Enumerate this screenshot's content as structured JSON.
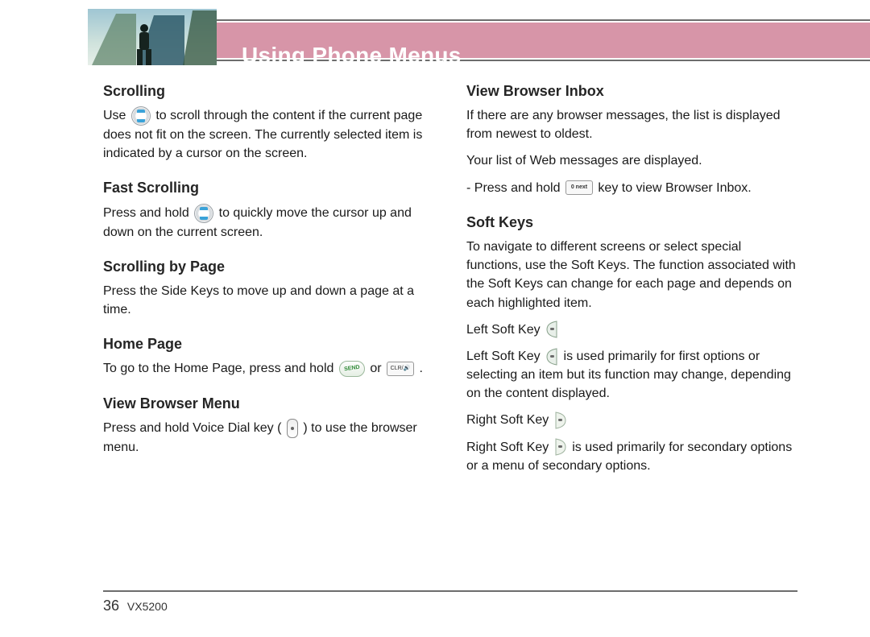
{
  "header": {
    "title": "Using Phone Menus"
  },
  "left": {
    "s1_head": "Scrolling",
    "s1_a": "Use",
    "s1_b": "to scroll through the content if the current page does not fit on the screen. The currently selected item is indicated by a cursor on the screen.",
    "s2_head": "Fast Scrolling",
    "s2_a": "Press and hold",
    "s2_b": "to quickly move the cursor up and down on the current screen.",
    "s3_head": "Scrolling by Page",
    "s3_body": "Press the Side Keys to move up and down a page at a time.",
    "s4_head": "Home Page",
    "s4_a": "To go to the Home Page, press and hold",
    "s4_b": "or",
    "s4_c": ".",
    "s5_head": "View Browser Menu",
    "s5_a": "Press and hold Voice Dial key (",
    "s5_b": ") to use the browser menu."
  },
  "right": {
    "s6_head": "View Browser Inbox",
    "s6_p1": "If there are any browser messages, the list is displayed from newest to oldest.",
    "s6_p2": "Your list of Web messages are displayed.",
    "s6_p3a": "- Press and hold",
    "s6_p3b": "key to view Browser Inbox.",
    "s7_head": "Soft Keys",
    "s7_p1": "To navigate to different screens or select special functions, use the Soft Keys. The function associated with the Soft Keys can change for each page and depends on each highlighted item.",
    "s7_lsk_label": "Left Soft Key",
    "s7_lsk_body": "is used primarily for first options or selecting an item but its function may change, depending on the content displayed.",
    "s7_rsk_label": "Right Soft Key",
    "s7_rsk_body": "is used primarily for secondary options or a menu of secondary options."
  },
  "footer": {
    "page_number": "36",
    "model": "VX5200"
  }
}
